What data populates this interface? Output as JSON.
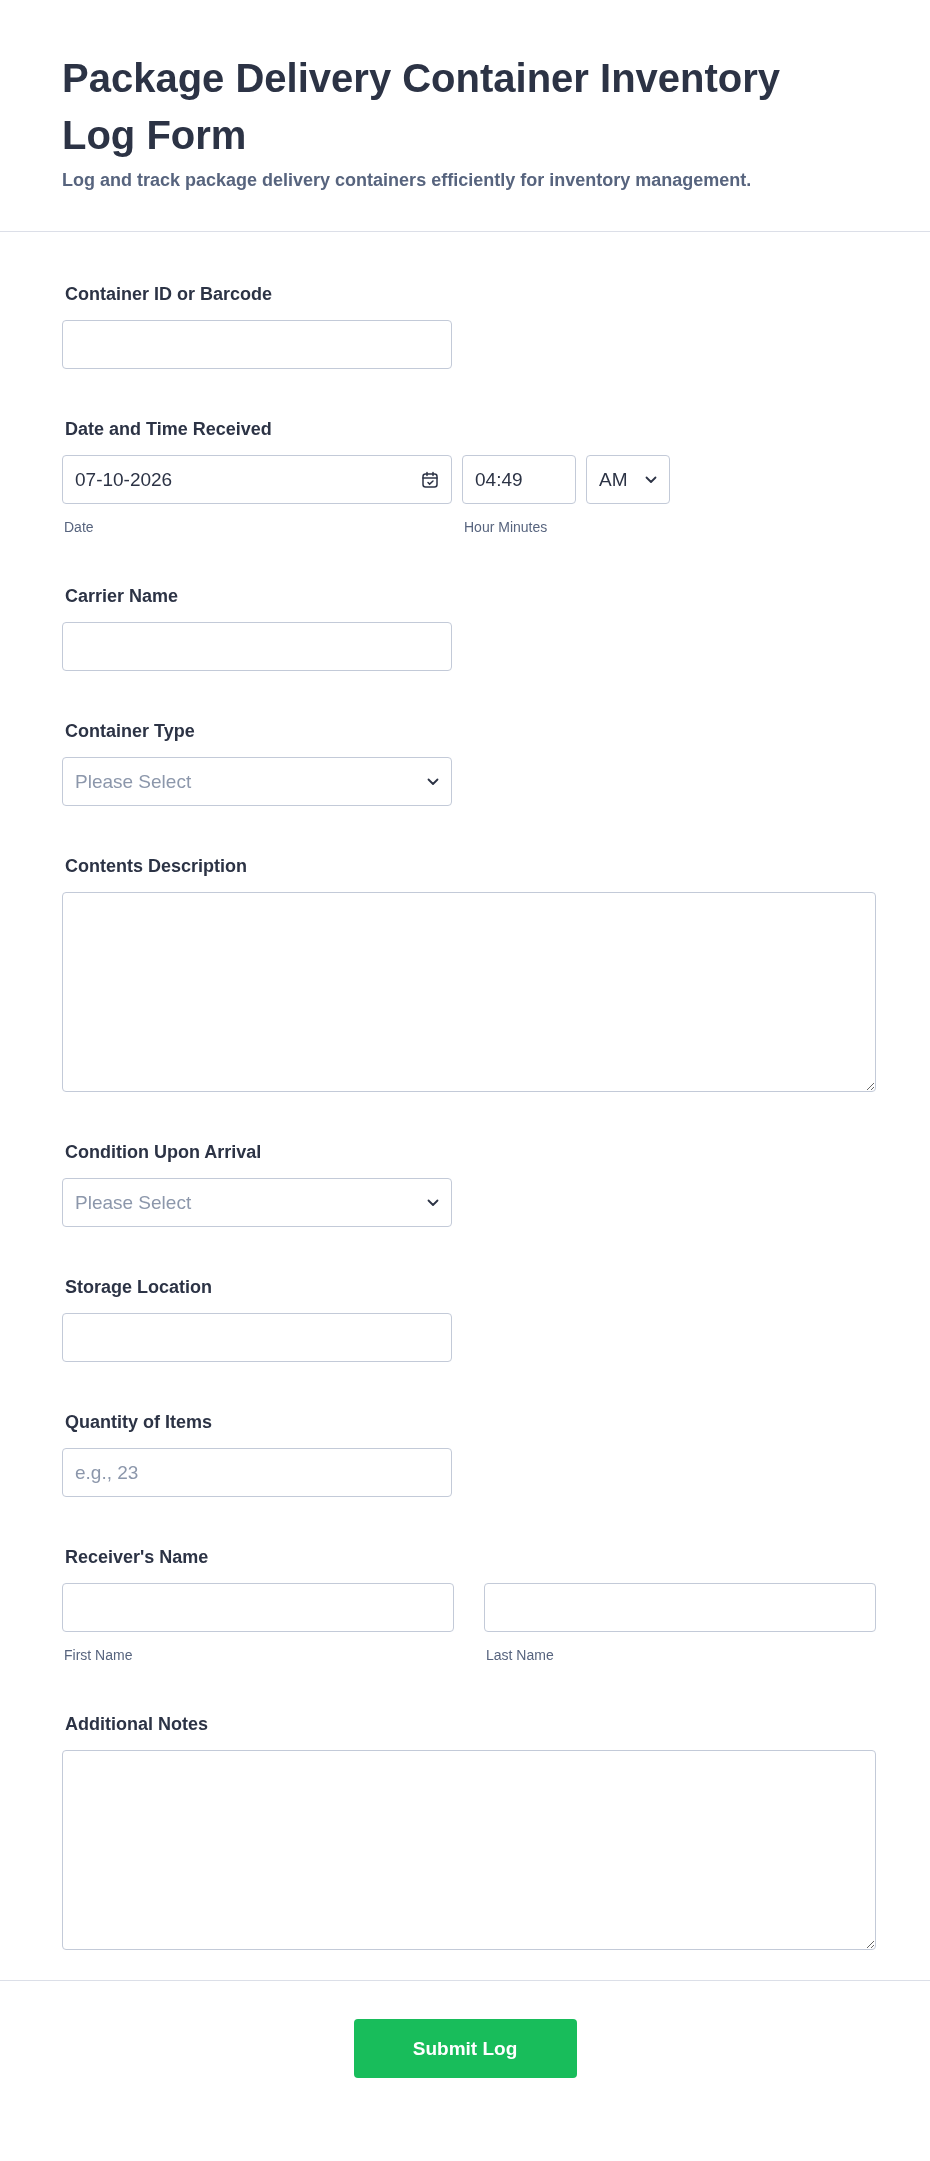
{
  "header": {
    "title": "Package Delivery Container Inventory Log Form",
    "description": "Log and track package delivery containers efficiently for inventory management."
  },
  "fields": [
    {
      "kind": "text",
      "label": "Container ID or Barcode"
    },
    {
      "kind": "datetime",
      "label": "Date and Time Received",
      "date": "07-10-2026",
      "time": "04:49",
      "ampm": "AM",
      "date_sublabel": "Date",
      "time_sublabel": "Hour Minutes"
    },
    {
      "kind": "text",
      "label": "Carrier Name"
    },
    {
      "kind": "select",
      "label": "Container Type",
      "placeholder": "Please Select"
    },
    {
      "kind": "textarea",
      "label": "Contents Description"
    },
    {
      "kind": "select",
      "label": "Condition Upon Arrival",
      "placeholder": "Please Select"
    },
    {
      "kind": "text",
      "label": "Storage Location"
    },
    {
      "kind": "text",
      "label": "Quantity of Items",
      "placeholder": "e.g., 23"
    },
    {
      "kind": "name",
      "label": "Receiver's Name",
      "first_sublabel": "First Name",
      "last_sublabel": "Last Name"
    },
    {
      "kind": "textarea",
      "label": "Additional Notes"
    }
  ],
  "submit": {
    "label": "Submit Log"
  }
}
